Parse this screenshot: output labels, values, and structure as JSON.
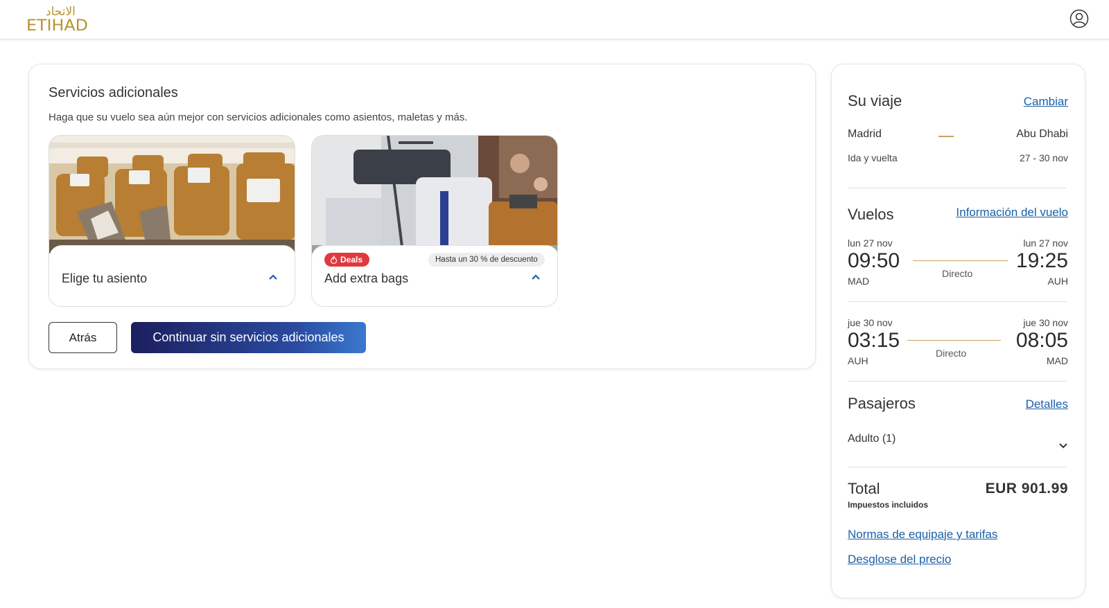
{
  "header": {
    "logo_arabic": "الاتحاد",
    "logo_latin": "ETIHAD",
    "user_icon": "user-circle-icon"
  },
  "services": {
    "title": "Servicios adicionales",
    "subtitle": "Haga que su vuelo sea aún mejor con servicios adicionales como asientos, maletas y más.",
    "seat_label": "Elige tu asiento",
    "bags_label": "Add extra bags",
    "deals_badge": "Deals",
    "discount_text": "Hasta un 30 % de descuento",
    "back_button": "Atrás",
    "continue_button": "Continuar sin servicios adicionales"
  },
  "trip": {
    "heading": "Su viaje",
    "change_link": "Cambiar",
    "origin": "Madrid",
    "destination": "Abu Dhabi",
    "trip_type": "Ida y vuelta",
    "dates": "27 - 30 nov"
  },
  "flights": {
    "heading": "Vuelos",
    "info_link": "Información del vuelo",
    "outbound": {
      "dep_date": "lun 27 nov",
      "dep_time": "09:50",
      "dep_code": "MAD",
      "arr_date": "lun 27 nov",
      "arr_time": "19:25",
      "arr_code": "AUH",
      "stops": "Directo"
    },
    "return": {
      "dep_date": "jue 30 nov",
      "dep_time": "03:15",
      "dep_code": "AUH",
      "arr_date": "jue 30 nov",
      "arr_time": "08:05",
      "arr_code": "MAD",
      "stops": "Directo"
    }
  },
  "passengers": {
    "heading": "Pasajeros",
    "details_link": "Detalles",
    "summary": "Adulto (1)"
  },
  "total": {
    "label": "Total",
    "taxes_note": "Impuestos incluidos",
    "price": "EUR 901.99"
  },
  "links": {
    "baggage_rules": "Normas de equipaje y tarifas",
    "price_breakdown": "Desglose del precio"
  },
  "colors": {
    "brand_gold": "#b8932f",
    "link_blue": "#1a5fa8",
    "deals_red": "#e0393e",
    "button_navy": "#1c1f5e"
  }
}
